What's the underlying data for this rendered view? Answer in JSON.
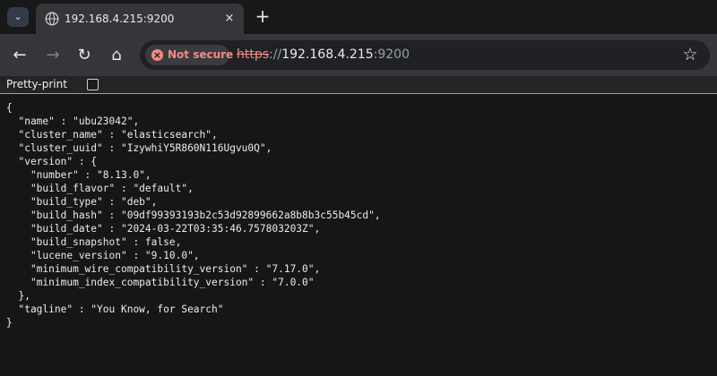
{
  "browser": {
    "tab": {
      "title": "192.168.4.215:9200",
      "close_label": "×",
      "new_tab_label": "+"
    },
    "icons": {
      "tab_search": "chevron-down-icon",
      "tab_favicon": "globe-icon",
      "back": "arrow-left-icon",
      "forward": "arrow-right-icon",
      "reload": "reload-icon",
      "home": "home-icon",
      "security": "warning-icon",
      "bookmark": "star-icon"
    },
    "symbols": {
      "tab_search": "⌄",
      "back": "←",
      "forward": "→",
      "reload": "↻",
      "home": "⌂",
      "security": "×",
      "bookmark": "☆"
    },
    "security_label": "Not secure",
    "url": {
      "scheme": "https",
      "separator": "://",
      "host": "192.168.4.215",
      "port": ":9200"
    },
    "colors": {
      "warning": "#f28b82",
      "toolbar": "#35363a",
      "page_background": "#161616"
    }
  },
  "page": {
    "pretty_print_label": "Pretty-print",
    "pretty_print_checked": false,
    "json_lines": [
      "{",
      "  \"name\" : \"ubu23042\",",
      "  \"cluster_name\" : \"elasticsearch\",",
      "  \"cluster_uuid\" : \"IzywhiY5R860N116Ugvu0Q\",",
      "  \"version\" : {",
      "    \"number\" : \"8.13.0\",",
      "    \"build_flavor\" : \"default\",",
      "    \"build_type\" : \"deb\",",
      "    \"build_hash\" : \"09df99393193b2c53d92899662a8b8b3c55b45cd\",",
      "    \"build_date\" : \"2024-03-22T03:35:46.757803203Z\",",
      "    \"build_snapshot\" : false,",
      "    \"lucene_version\" : \"9.10.0\",",
      "    \"minimum_wire_compatibility_version\" : \"7.17.0\",",
      "    \"minimum_index_compatibility_version\" : \"7.0.0\"",
      "  },",
      "  \"tagline\" : \"You Know, for Search\"",
      "}"
    ]
  }
}
